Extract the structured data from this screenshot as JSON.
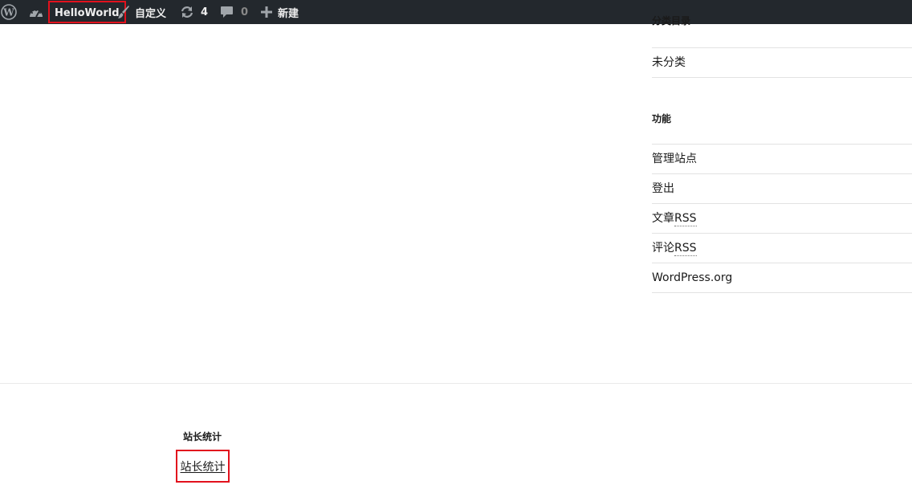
{
  "admin_bar": {
    "wp_logo_icon": "wordpress-logo",
    "site_icon": "dashboard-gauge",
    "site_name": "HelloWorld",
    "customize_icon": "paintbrush",
    "customize_label": "自定义",
    "updates_icon": "refresh",
    "updates_count": "4",
    "comments_icon": "speech-bubble",
    "comments_count": "0",
    "new_icon": "plus",
    "new_label": "新建",
    "bar_color": "#23282d",
    "highlight_color": "#e2111d"
  },
  "sidebar": {
    "categories_title_partial": "分类目录",
    "categories": [
      "未分类"
    ],
    "meta_title": "功能",
    "meta_items": [
      "管理站点",
      "登出"
    ],
    "meta_rss": [
      {
        "prefix": "文章",
        "abbr": "RSS"
      },
      {
        "prefix": "评论",
        "abbr": "RSS"
      }
    ],
    "meta_org": "WordPress.org"
  },
  "footer": {
    "widget_title": "站长统计",
    "link_label": "站长统计"
  }
}
